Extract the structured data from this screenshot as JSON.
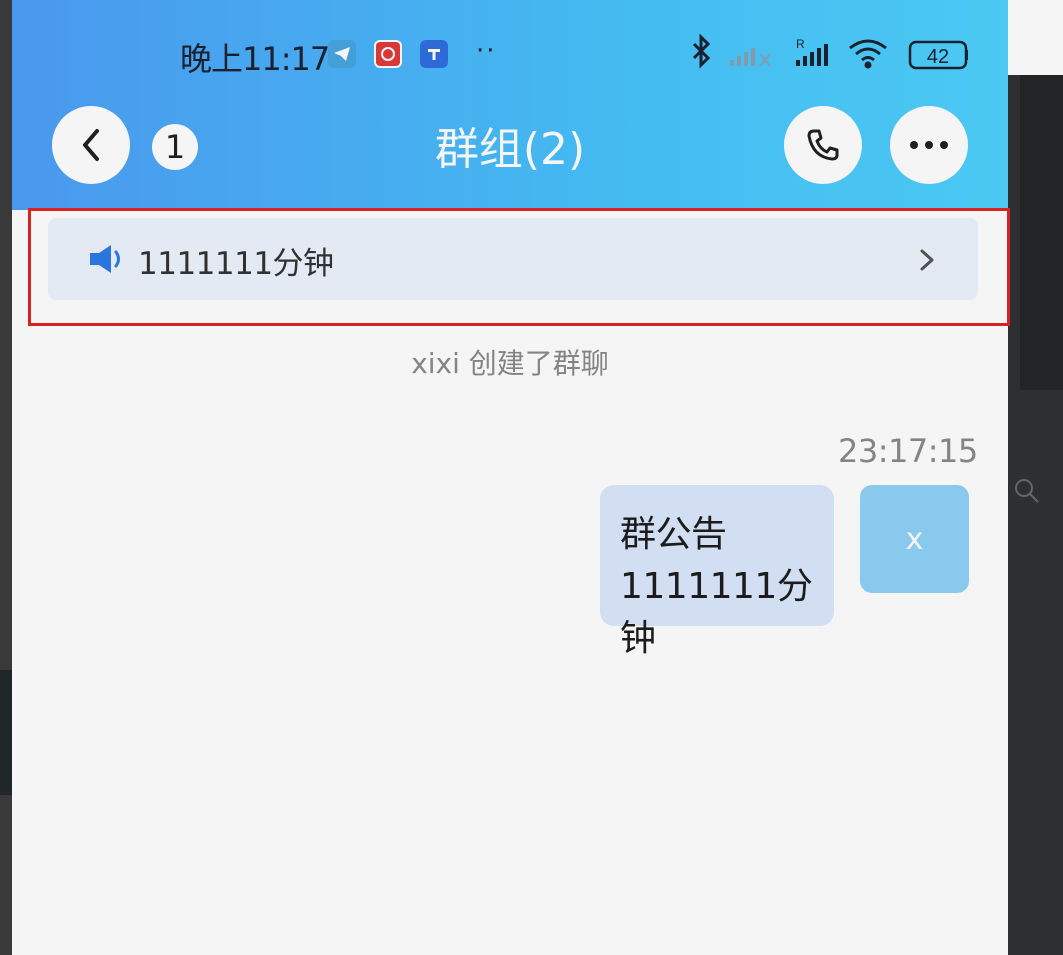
{
  "status_bar": {
    "time": "晚上11:17",
    "app_icons": [
      "telegram-icon",
      "red-app-icon",
      "t-app-icon"
    ],
    "more_indicator": "··",
    "battery": "42",
    "signal_roaming_label": "R"
  },
  "header": {
    "title": "群组(2)",
    "unread_badge": "1",
    "back_icon": "chevron-left-icon",
    "call_icon": "phone-icon",
    "more_icon": "more-horizontal-icon"
  },
  "notice_bar": {
    "text": "1111111分钟",
    "icon": "speaker-icon",
    "chevron_icon": "chevron-right-icon"
  },
  "system_message": "xixi 创建了群聊",
  "message": {
    "timestamp": "23:17:15",
    "bubble_lines": [
      "群公告",
      "1111111分钟"
    ],
    "avatar_text": "x"
  },
  "colors": {
    "header_gradient_start": "#4d9ff7",
    "header_gradient_end": "#4fd2fc",
    "bubble_bg": "#dbe9fc",
    "avatar_bg": "#8fd2f7",
    "notice_bg": "#eef4fd",
    "highlight_border": "#e02424"
  }
}
